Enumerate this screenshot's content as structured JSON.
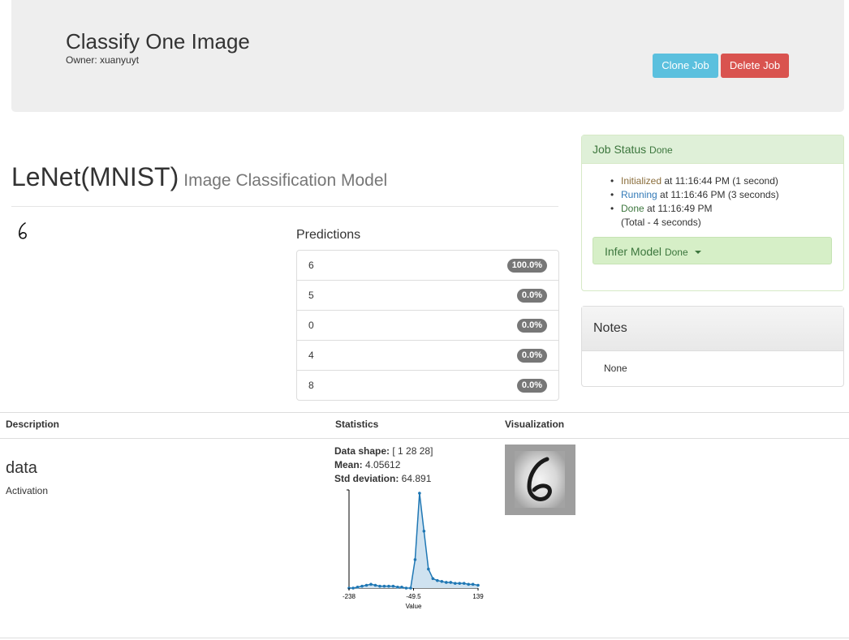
{
  "header": {
    "title": "Classify One Image",
    "owner": "Owner: xuanyuyt",
    "clone_label": "Clone Job",
    "delete_label": "Delete Job"
  },
  "model": {
    "name": "LeNet(MNIST)",
    "subtitle": "Image Classification Model"
  },
  "predictions": {
    "label": "Predictions",
    "items": [
      {
        "label": "6",
        "value": "100.0%"
      },
      {
        "label": "5",
        "value": "0.0%"
      },
      {
        "label": "0",
        "value": "0.0%"
      },
      {
        "label": "4",
        "value": "0.0%"
      },
      {
        "label": "8",
        "value": "0.0%"
      }
    ]
  },
  "job_status": {
    "title": "Job Status",
    "state": "Done",
    "events": [
      {
        "state": "Initialized",
        "at": " at 11:16:44 PM ",
        "duration": "(1 second)"
      },
      {
        "state": "Running",
        "at": " at 11:16:46 PM ",
        "duration": "(3 seconds)"
      },
      {
        "state": "Done",
        "at": " at 11:16:49 PM",
        "duration": ""
      }
    ],
    "total": "(Total - 4 seconds)",
    "infer_label": "Infer Model",
    "infer_state": "Done"
  },
  "notes": {
    "title": "Notes",
    "body": "None"
  },
  "table": {
    "col_description": "Description",
    "col_statistics": "Statistics",
    "col_visualization": "Visualization",
    "layer_name": "data",
    "layer_type": "Activation",
    "shape_label": "Data shape:",
    "shape_value": " [ 1 28 28]",
    "mean_label": "Mean:",
    "mean_value": " 4.05612",
    "std_label": "Std deviation:",
    "std_value": " 64.891"
  },
  "chart_data": {
    "type": "area",
    "xlabel": "Value",
    "ylabel": "",
    "tick_labels": [
      "-238",
      "-49.5",
      "139"
    ],
    "xlim": [
      -238,
      139
    ],
    "x": [
      -238,
      -226,
      -213,
      -200,
      -187,
      -174,
      -161,
      -148,
      -135,
      -122,
      -109,
      -96,
      -84,
      -71,
      -58,
      -45,
      -32,
      -19,
      -6,
      7,
      20,
      33,
      46,
      59,
      72,
      85,
      98,
      111,
      124,
      139
    ],
    "y": [
      0,
      0,
      1,
      2,
      3,
      4,
      3,
      2,
      2,
      2,
      2,
      1,
      1,
      0,
      0,
      30,
      100,
      60,
      20,
      10,
      8,
      7,
      6,
      6,
      5,
      5,
      5,
      4,
      4,
      3
    ],
    "ylim": [
      0,
      100
    ],
    "color": "#1f77b4"
  }
}
